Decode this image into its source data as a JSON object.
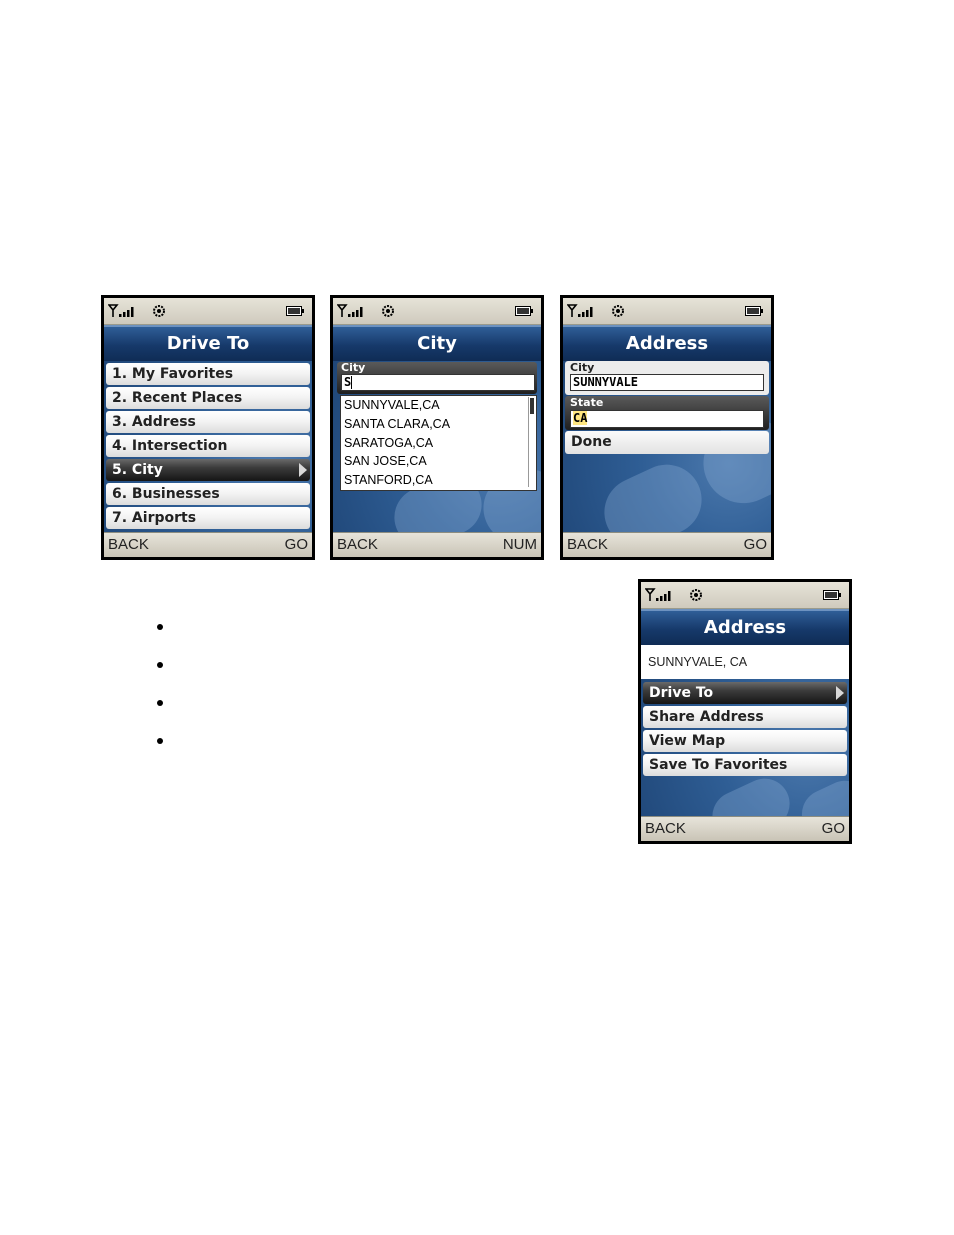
{
  "screens": {
    "drive_to": {
      "title": "Drive To",
      "items": [
        "1. My Favorites",
        "2. Recent Places",
        "3. Address",
        "4. Intersection",
        "5. City",
        "6. Businesses",
        "7. Airports"
      ],
      "selected_index": 4,
      "softkey_left": "BACK",
      "softkey_right": "GO"
    },
    "city": {
      "title": "City",
      "field_label": "City",
      "field_value": "S",
      "suggestions": [
        "SUNNYVALE,CA",
        "SANTA CLARA,CA",
        "SARATOGA,CA",
        "SAN JOSE,CA",
        "STANFORD,CA"
      ],
      "softkey_left": "BACK",
      "softkey_right": "NUM"
    },
    "address_entry": {
      "title": "Address",
      "city_label": "City",
      "city_value": "SUNNYVALE",
      "state_label": "State",
      "state_value": "CA",
      "done_label": "Done",
      "softkey_left": "BACK",
      "softkey_right": "GO"
    },
    "address_result": {
      "title": "Address",
      "address": "SUNNYVALE, CA",
      "items": [
        "Drive To",
        "Share Address",
        "View Map",
        "Save To Favorites"
      ],
      "selected_index": 0,
      "softkey_left": "BACK",
      "softkey_right": "GO"
    }
  },
  "icons": [
    "signal-icon",
    "settings-gear-icon",
    "battery-icon"
  ],
  "colors": {
    "title_bar": "#16396a",
    "highlight": "#ffe680",
    "selected_row": "#2a2a2a"
  }
}
